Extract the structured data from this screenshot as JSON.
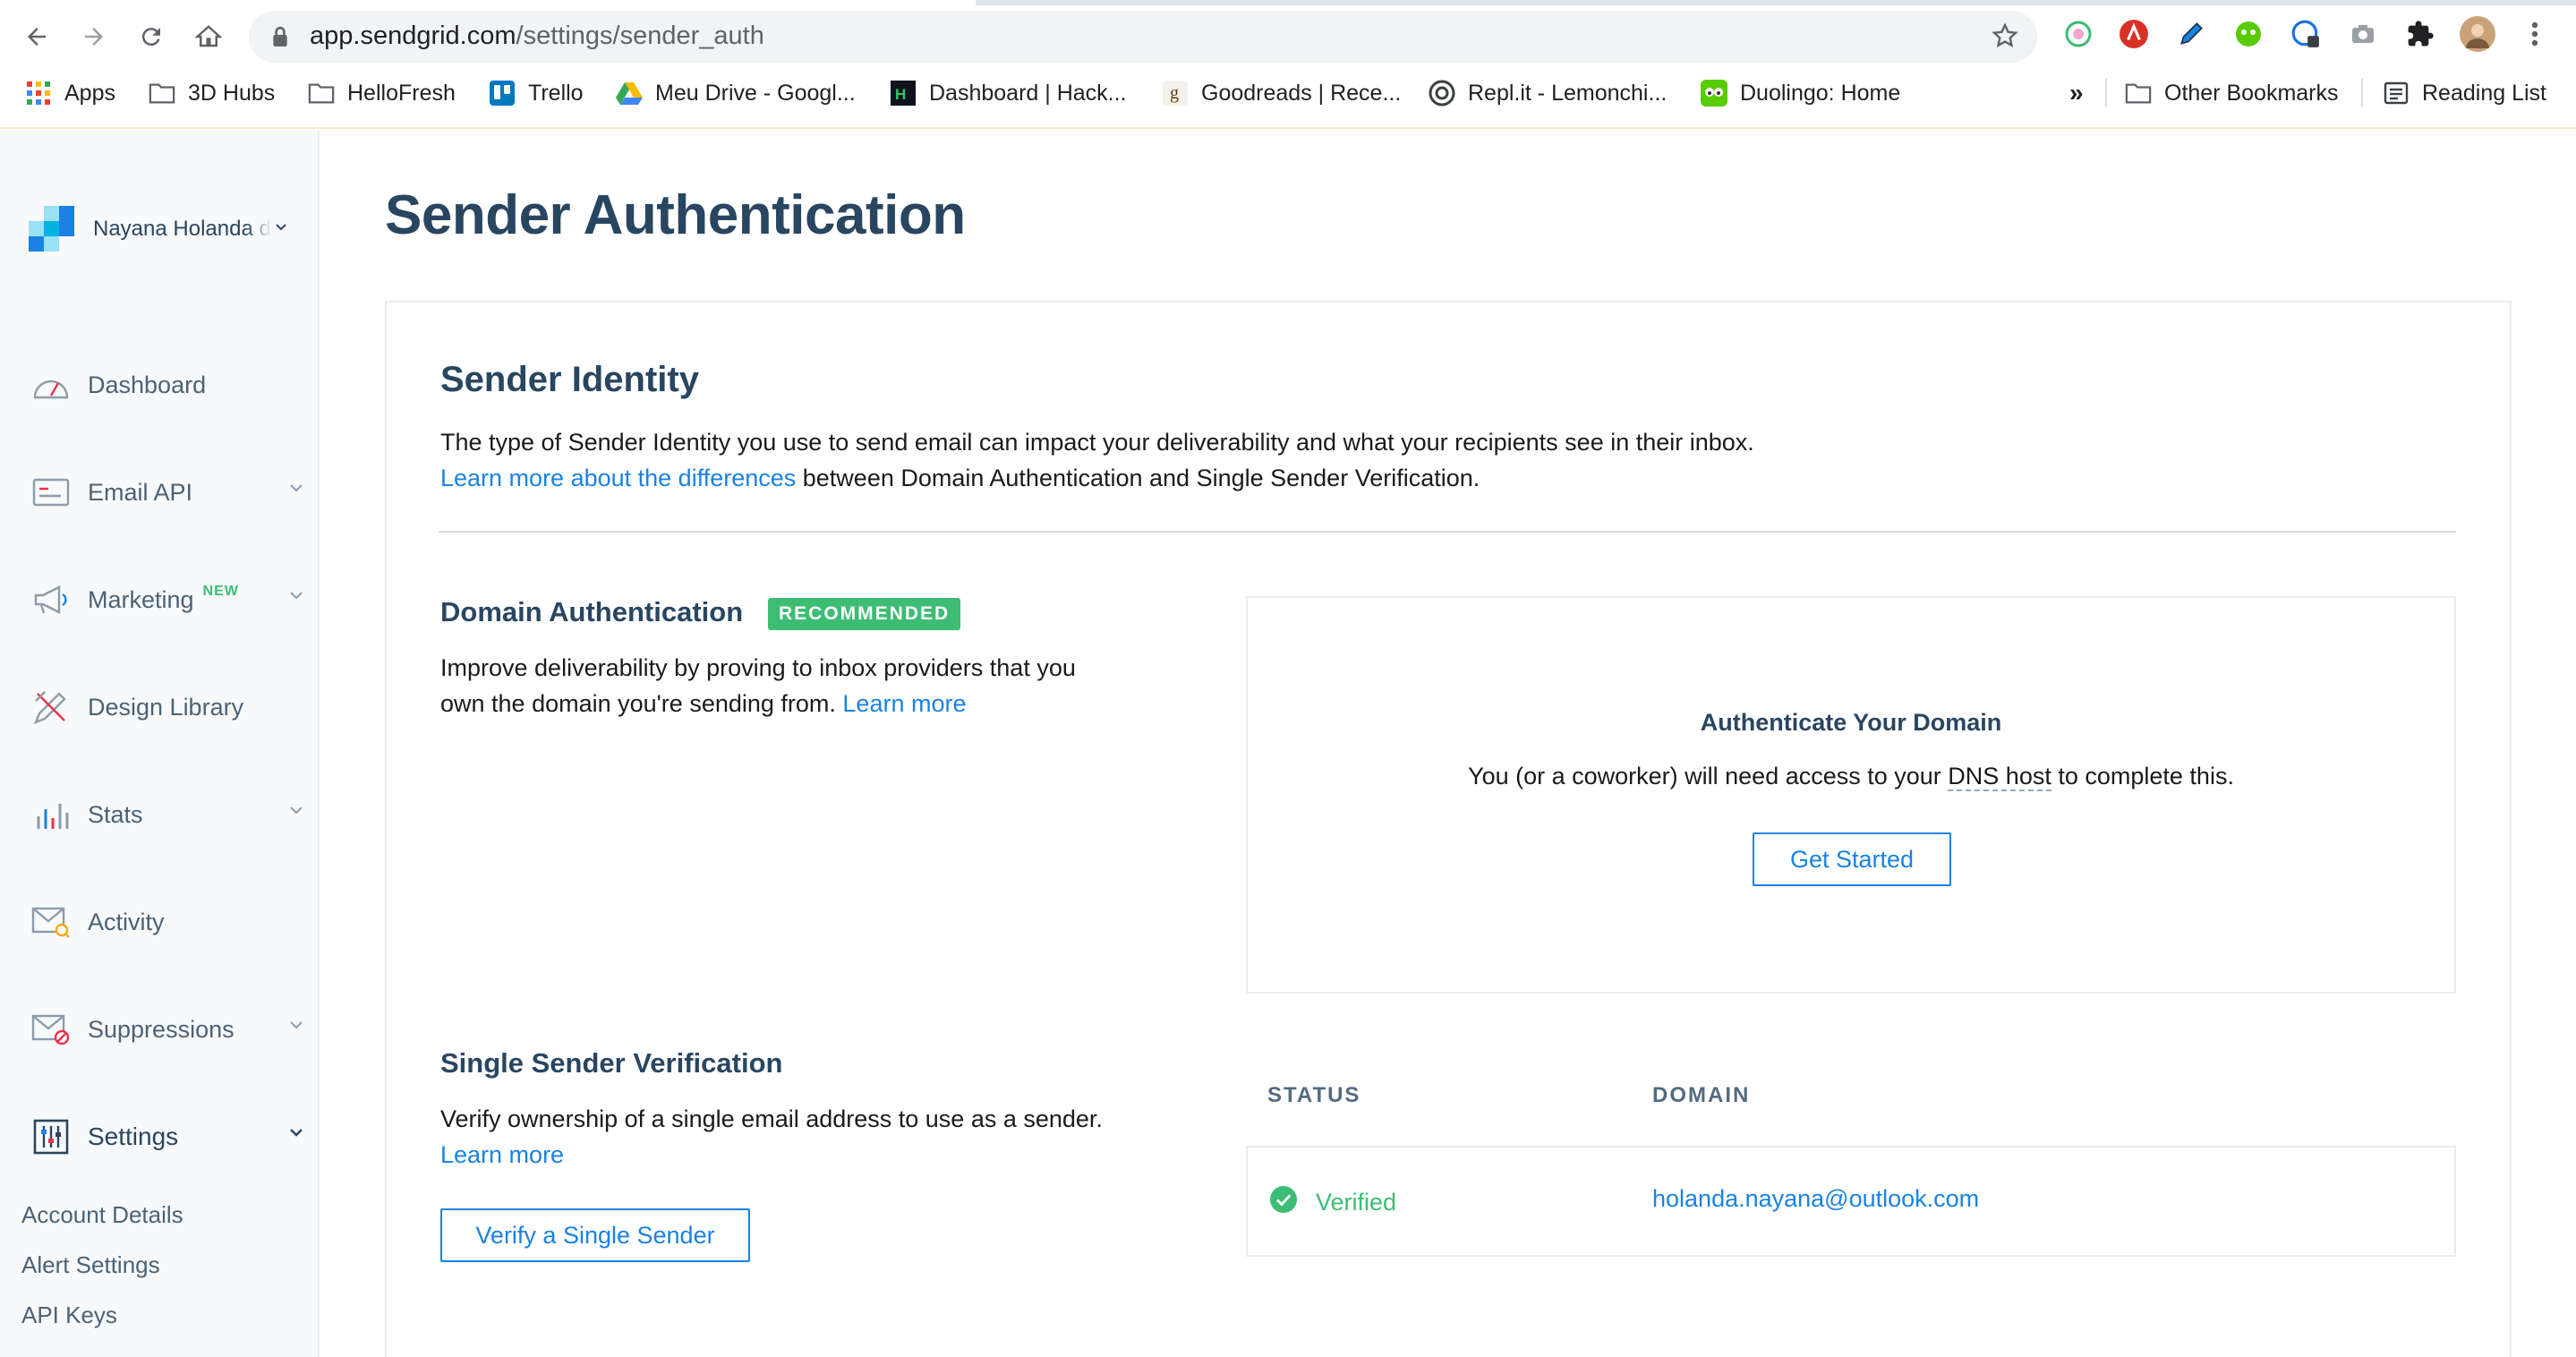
{
  "browser": {
    "url_host": "app.sendgrid.com",
    "url_path": "/settings/sender_auth",
    "bookmarks": [
      {
        "label": "Apps",
        "icon": "apps-grid-icon"
      },
      {
        "label": "3D Hubs",
        "icon": "folder-icon"
      },
      {
        "label": "HelloFresh",
        "icon": "folder-icon"
      },
      {
        "label": "Trello",
        "icon": "trello-icon"
      },
      {
        "label": "Meu Drive - Googl...",
        "icon": "google-drive-icon"
      },
      {
        "label": "Dashboard | Hack...",
        "icon": "hackerrank-icon"
      },
      {
        "label": "Goodreads | Rece...",
        "icon": "goodreads-icon"
      },
      {
        "label": "Repl.it - Lemonchi...",
        "icon": "replit-icon"
      },
      {
        "label": "Duolingo: Home",
        "icon": "duolingo-icon"
      }
    ],
    "overflow_label": "»",
    "other_bookmarks": "Other Bookmarks",
    "reading_list": "Reading List"
  },
  "sidebar": {
    "account_name": "Nayana Holanda de",
    "nav": [
      {
        "label": "Dashboard",
        "icon": "dashboard-gauge-icon",
        "has_chevron": false
      },
      {
        "label": "Email API",
        "icon": "email-api-icon",
        "has_chevron": true
      },
      {
        "label": "Marketing",
        "icon": "megaphone-icon",
        "badge": "NEW",
        "has_chevron": true
      },
      {
        "label": "Design Library",
        "icon": "design-tools-icon",
        "has_chevron": false
      },
      {
        "label": "Stats",
        "icon": "stats-chart-icon",
        "has_chevron": true
      },
      {
        "label": "Activity",
        "icon": "activity-envelope-icon",
        "has_chevron": false
      },
      {
        "label": "Suppressions",
        "icon": "suppressions-envelope-icon",
        "has_chevron": true
      },
      {
        "label": "Settings",
        "icon": "settings-sliders-icon",
        "has_chevron": true,
        "active": true
      }
    ],
    "settings_subnav": [
      "Account Details",
      "Alert Settings",
      "API Keys"
    ]
  },
  "main": {
    "page_title": "Sender Authentication",
    "sender_identity": {
      "title": "Sender Identity",
      "description": "The type of Sender Identity you use to send email can impact your deliverability and what your recipients see in their inbox.",
      "learn_link": "Learn more about the differences",
      "learn_suffix": " between Domain Authentication and Single Sender Verification."
    },
    "domain_auth": {
      "title": "Domain Authentication",
      "badge": "RECOMMENDED",
      "description": "Improve deliverability by proving to inbox providers that you own the domain you're sending from. ",
      "learn_more": "Learn more",
      "box_title": "Authenticate Your Domain",
      "box_desc_prefix": "You (or a coworker) will need access to your ",
      "box_desc_dns": "DNS host",
      "box_desc_suffix": " to complete this.",
      "button": "Get Started"
    },
    "single_sender": {
      "title": "Single Sender Verification",
      "description": "Verify ownership of a single email address to use as a sender. ",
      "learn_more": "Learn more",
      "button": "Verify a Single Sender",
      "columns": [
        "STATUS",
        "DOMAIN"
      ],
      "rows": [
        {
          "status": "Verified",
          "domain": "holanda.nayana@outlook.com"
        }
      ]
    }
  },
  "colors": {
    "brand_navy": "#294661",
    "link_blue": "#1a82e2",
    "success_green": "#3dbc74"
  }
}
